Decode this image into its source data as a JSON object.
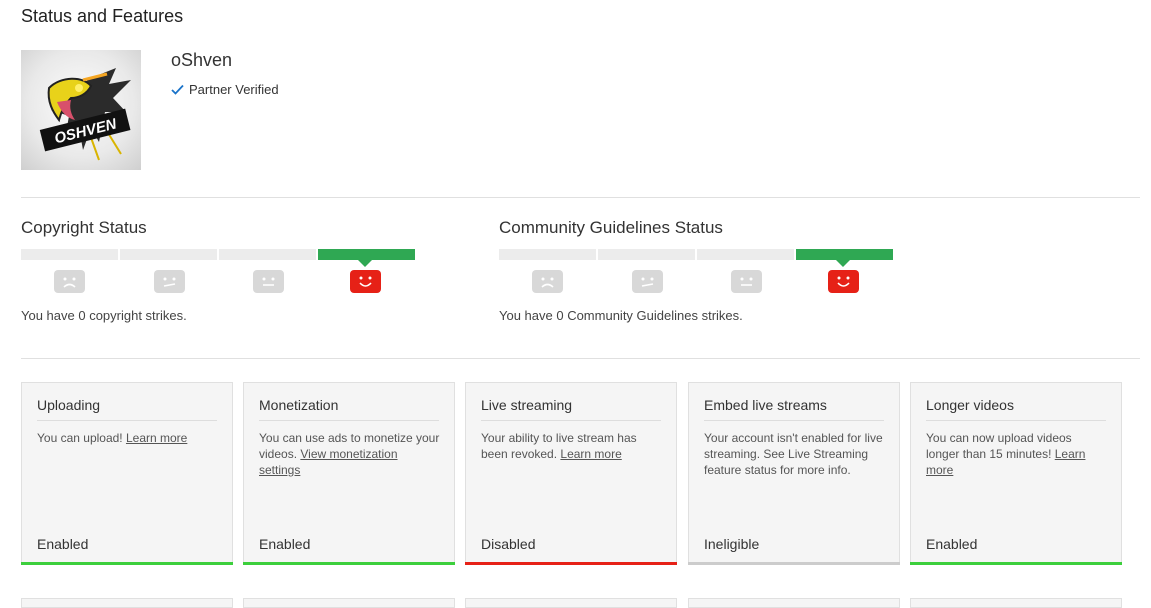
{
  "page": {
    "title": "Status and Features"
  },
  "channel": {
    "name": "oShven",
    "partner_label": "Partner Verified",
    "avatar_text": "OSHVEN"
  },
  "copyright": {
    "title": "Copyright Status",
    "strike_text": "You have 0 copyright strikes.",
    "strikes": 0,
    "segments": 4,
    "active_segment": 4
  },
  "community": {
    "title": "Community Guidelines Status",
    "strike_text": "You have 0 Community Guidelines strikes.",
    "strikes": 0,
    "segments": 4,
    "active_segment": 4
  },
  "colors": {
    "enabled": "#3ccf3c",
    "disabled": "#e62117",
    "ineligible": "#cccccc",
    "strike_active": "#2fa853",
    "face_active": "#e62117",
    "face_inactive": "#d8d8d8"
  },
  "features": [
    {
      "title": "Uploading",
      "desc_text": "You can upload! ",
      "link": "Learn more",
      "status": "Enabled",
      "state": "enabled"
    },
    {
      "title": "Monetization",
      "desc_text": "You can use ads to monetize your videos. ",
      "link": "View monetization settings",
      "status": "Enabled",
      "state": "enabled"
    },
    {
      "title": "Live streaming",
      "desc_text": "Your ability to live stream has been revoked. ",
      "link": "Learn more",
      "status": "Disabled",
      "state": "disabled"
    },
    {
      "title": "Embed live streams",
      "desc_text": "Your account isn't enabled for live streaming. See Live Streaming feature status for more info.",
      "link": "",
      "status": "Ineligible",
      "state": "ineligible"
    },
    {
      "title": "Longer videos",
      "desc_text": "You can now upload videos longer than 15 minutes! ",
      "link": "Learn more",
      "status": "Enabled",
      "state": "enabled"
    }
  ]
}
